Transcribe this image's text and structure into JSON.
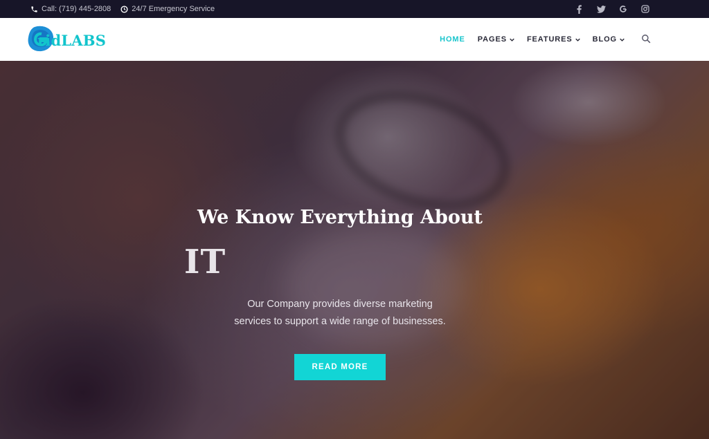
{
  "topbar": {
    "phone": "Call: (719) 445-2808",
    "service": "24/7 Emergency Service",
    "socials": [
      {
        "icon": "facebook-icon",
        "glyph": "f"
      },
      {
        "icon": "twitter-icon",
        "glyph": "t"
      },
      {
        "icon": "google-icon",
        "glyph": "G"
      },
      {
        "icon": "instagram-icon",
        "glyph": "ig"
      }
    ]
  },
  "header": {
    "logo_text": "ridLABS",
    "nav": [
      {
        "label": "HOME",
        "active": true
      },
      {
        "label": "PAGES",
        "dropdown": true
      },
      {
        "label": "FEATURES",
        "dropdown": true
      },
      {
        "label": "BLOG",
        "dropdown": true
      }
    ],
    "search_icon": "search-icon"
  },
  "hero": {
    "title": "We Know Everything About",
    "subtitle": "IT",
    "text_line1": "Our Company provides diverse marketing",
    "text_line2": "services to support a wide range of businesses.",
    "button": "READ MORE"
  },
  "colors": {
    "accent": "#12d5d5",
    "topbar_bg": "#171528",
    "logo": "#12c4cc"
  }
}
